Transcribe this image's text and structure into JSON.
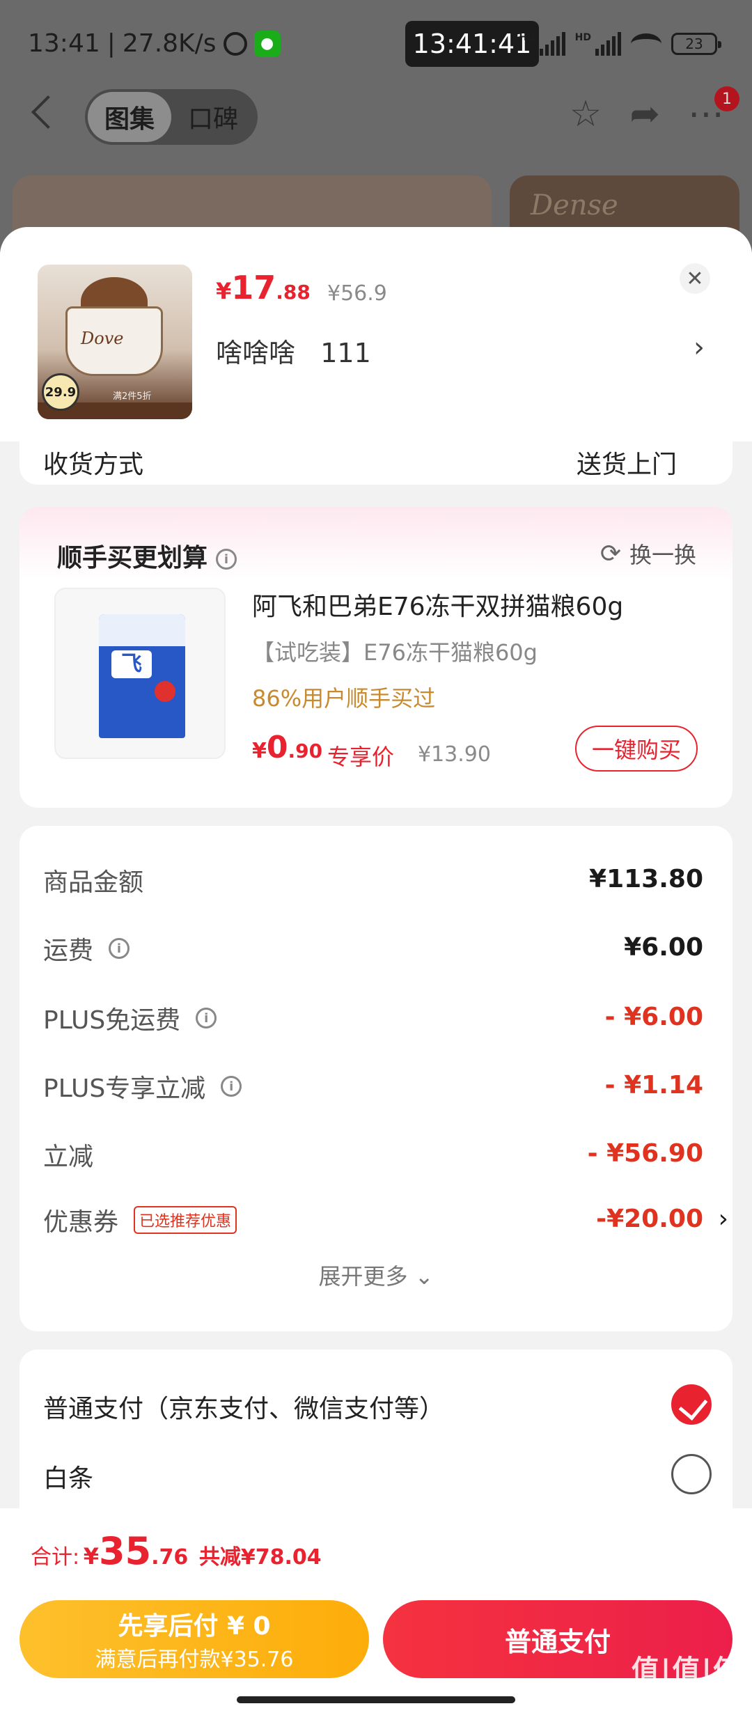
{
  "status_bar": {
    "time": "13:41",
    "net_speed": "27.8K/s",
    "clock_overlay": "13:41:41",
    "battery": "23",
    "hd_label": "HD"
  },
  "nav": {
    "tabs": [
      {
        "label": "图集",
        "active": true
      },
      {
        "label": "口碑",
        "active": false
      }
    ],
    "notification_count": "1"
  },
  "background": {
    "banner_text": "Dense"
  },
  "product": {
    "image_brand": "Dove",
    "image_tag_price": "29.9",
    "image_promo": "满2件5折",
    "price_symbol": "¥",
    "price_int": "17",
    "price_dec": ".88",
    "original_price": "¥56.9",
    "variant": "啥啥啥   111"
  },
  "shipping": {
    "label": "收货方式",
    "value": "送货上门"
  },
  "recommend": {
    "title": "顺手买更划算",
    "swap_label": "换一换",
    "item": {
      "image_mark": "飞",
      "name": "阿飞和巴弟E76冻干双拼猫粮60g",
      "subtitle": "【试吃装】E76冻干猫粮60g",
      "social_proof": "86%用户顺手买过",
      "price_symbol": "¥",
      "price_int": "0",
      "price_dec": ".90",
      "exclusive_label": "专享价",
      "original_price": "¥13.90",
      "buy_label": "一键购买"
    }
  },
  "summary": {
    "rows": [
      {
        "label": "商品金额",
        "value": "¥113.80",
        "info": false,
        "red": false
      },
      {
        "label": "运费",
        "value": "¥6.00",
        "info": true,
        "red": false
      },
      {
        "label": "PLUS免运费",
        "value": "- ¥6.00",
        "info": true,
        "red": true
      },
      {
        "label": "PLUS专享立减",
        "value": "- ¥1.14",
        "info": true,
        "red": true
      },
      {
        "label": "立减",
        "value": "- ¥56.90",
        "info": false,
        "red": true
      }
    ],
    "coupon": {
      "label": "优惠券",
      "tag": "已选推荐优惠",
      "value": "-¥20.00"
    },
    "expand_label": "展开更多"
  },
  "payment": {
    "options": [
      {
        "label": "普通支付（京东支付、微信支付等）",
        "selected": true
      },
      {
        "label": "白条",
        "selected": false
      }
    ]
  },
  "footer": {
    "total_label": "合计:",
    "total_symbol": "¥",
    "total_int": "35",
    "total_dec": ".76",
    "saved": "共减¥78.04",
    "pay_later_title": "先享后付 ¥ 0",
    "pay_later_sub": "满意后再付款¥35.76",
    "pay_normal": "普通支付",
    "watermark": "值|值|值",
    "watermark_url": "zhizhizhi.com"
  },
  "colors": {
    "accent_red": "#e8232f",
    "discount_red": "#e0331f",
    "gold": "#c88a2e",
    "pay_later_yellow": "#fdb51c"
  }
}
